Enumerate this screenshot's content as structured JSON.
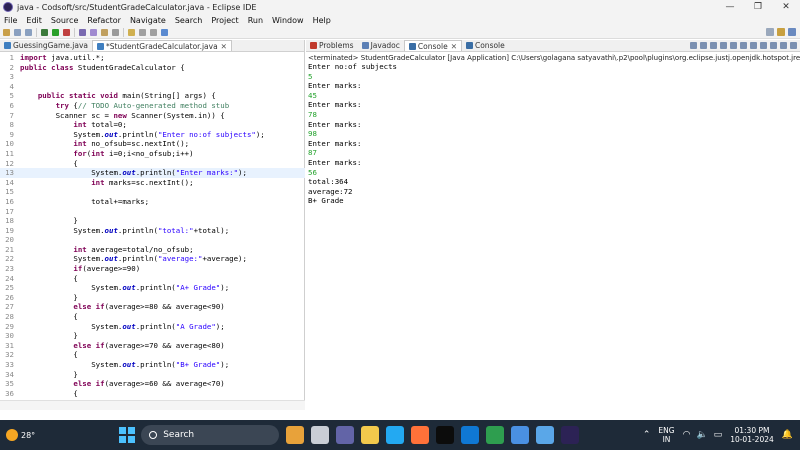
{
  "window": {
    "title": "java - Codsoft/src/StudentGradeCalculator.java - Eclipse IDE",
    "minimize": "—",
    "maximize": "❐",
    "close": "✕"
  },
  "menu": [
    "File",
    "Edit",
    "Source",
    "Refactor",
    "Navigate",
    "Search",
    "Project",
    "Run",
    "Window",
    "Help"
  ],
  "editor": {
    "tabs": [
      {
        "label": "GuessingGame.java",
        "active": false
      },
      {
        "label": "*StudentGradeCalculator.java",
        "active": true,
        "close": "✕"
      }
    ],
    "lines": [
      {
        "n": "1",
        "text": "import java.util.*;"
      },
      {
        "n": "2",
        "text": "public class StudentGradeCalculator {"
      },
      {
        "n": "3",
        "text": ""
      },
      {
        "n": "4",
        "text": ""
      },
      {
        "n": "5",
        "text": "    public static void main(String[] args) {"
      },
      {
        "n": "6",
        "text": "        try {// TODO Auto-generated method stub"
      },
      {
        "n": "7",
        "text": "        Scanner sc = new Scanner(System.in)) {"
      },
      {
        "n": "8",
        "text": "            int total=0;"
      },
      {
        "n": "9",
        "text": "            System.out.println(\"Enter no:of subjects\");"
      },
      {
        "n": "10",
        "text": "            int no_ofsub=sc.nextInt();"
      },
      {
        "n": "11",
        "text": "            for(int i=0;i<no_ofsub;i++)"
      },
      {
        "n": "12",
        "text": "            {"
      },
      {
        "n": "13",
        "text": "                System.out.println(\"Enter marks:\");",
        "highlight": true
      },
      {
        "n": "14",
        "text": "                int marks=sc.nextInt();"
      },
      {
        "n": "15",
        "text": ""
      },
      {
        "n": "16",
        "text": "                total+=marks;"
      },
      {
        "n": "17",
        "text": ""
      },
      {
        "n": "18",
        "text": "            }"
      },
      {
        "n": "19",
        "text": "            System.out.println(\"total:\"+total);"
      },
      {
        "n": "20",
        "text": ""
      },
      {
        "n": "21",
        "text": "            int average=total/no_ofsub;"
      },
      {
        "n": "22",
        "text": "            System.out.println(\"average:\"+average);"
      },
      {
        "n": "23",
        "text": "            if(average>=90)"
      },
      {
        "n": "24",
        "text": "            {"
      },
      {
        "n": "25",
        "text": "                System.out.println(\"A+ Grade\");"
      },
      {
        "n": "26",
        "text": "            }"
      },
      {
        "n": "27",
        "text": "            else if(average>=80 && average<90)"
      },
      {
        "n": "28",
        "text": "            {"
      },
      {
        "n": "29",
        "text": "                System.out.println(\"A Grade\");"
      },
      {
        "n": "30",
        "text": "            }"
      },
      {
        "n": "31",
        "text": "            else if(average>=70 && average<80)"
      },
      {
        "n": "32",
        "text": "            {"
      },
      {
        "n": "33",
        "text": "                System.out.println(\"B+ Grade\");"
      },
      {
        "n": "34",
        "text": "            }"
      },
      {
        "n": "35",
        "text": "            else if(average>=60 && average<70)"
      },
      {
        "n": "36",
        "text": "            {"
      }
    ]
  },
  "console": {
    "tabs": [
      {
        "label": "Problems",
        "active": false,
        "color": "#c0392b"
      },
      {
        "label": "Javadoc",
        "active": false,
        "color": "#5b7fb5"
      },
      {
        "label": "Console",
        "active": true,
        "color": "#3a6ea5",
        "close": "✕"
      },
      {
        "label": "Console",
        "active": false,
        "color": "#3a6ea5"
      }
    ],
    "header": "<terminated> StudentGradeCalculator [Java Application] C:\\Users\\golagana satyavathi\\.p2\\pool\\plugins\\org.eclipse.justj.openjdk.hotspot.jre.full.wi",
    "output": [
      {
        "text": "Enter no:of subjects",
        "input": false
      },
      {
        "text": "5",
        "input": true
      },
      {
        "text": "Enter marks:",
        "input": false
      },
      {
        "text": "45",
        "input": true
      },
      {
        "text": "Enter marks:",
        "input": false
      },
      {
        "text": "78",
        "input": true
      },
      {
        "text": "Enter marks:",
        "input": false
      },
      {
        "text": "98",
        "input": true
      },
      {
        "text": "Enter marks:",
        "input": false
      },
      {
        "text": "87",
        "input": true
      },
      {
        "text": "Enter marks:",
        "input": false
      },
      {
        "text": "56",
        "input": true
      },
      {
        "text": "total:364",
        "input": false
      },
      {
        "text": "average:72",
        "input": false
      },
      {
        "text": "B+ Grade",
        "input": false
      }
    ]
  },
  "taskbar": {
    "temperature": "28°",
    "search_label": "Search",
    "language_top": "ENG",
    "language_bottom": "IN",
    "time": "01:30 PM",
    "date": "10-01-2024",
    "apps": [
      {
        "name": "widgets-app-icon",
        "color": "#e8a23a"
      },
      {
        "name": "file-manager-icon",
        "color": "#c9ced6"
      },
      {
        "name": "teams-icon",
        "color": "#6264a7"
      },
      {
        "name": "folder-icon",
        "color": "#f2c94c"
      },
      {
        "name": "vscode-icon",
        "color": "#23a9f2"
      },
      {
        "name": "firefox-icon",
        "color": "#ff7139"
      },
      {
        "name": "terminal-icon",
        "color": "#0c0c0c"
      },
      {
        "name": "mail-icon",
        "color": "#0f78d4"
      },
      {
        "name": "chrome-icon",
        "color": "#2e9e4f"
      },
      {
        "name": "droplet-app-icon",
        "color": "#4a90e2"
      },
      {
        "name": "notes-app-icon",
        "color": "#5aa7e8"
      },
      {
        "name": "eclipse-icon",
        "color": "#2c2255"
      }
    ]
  }
}
